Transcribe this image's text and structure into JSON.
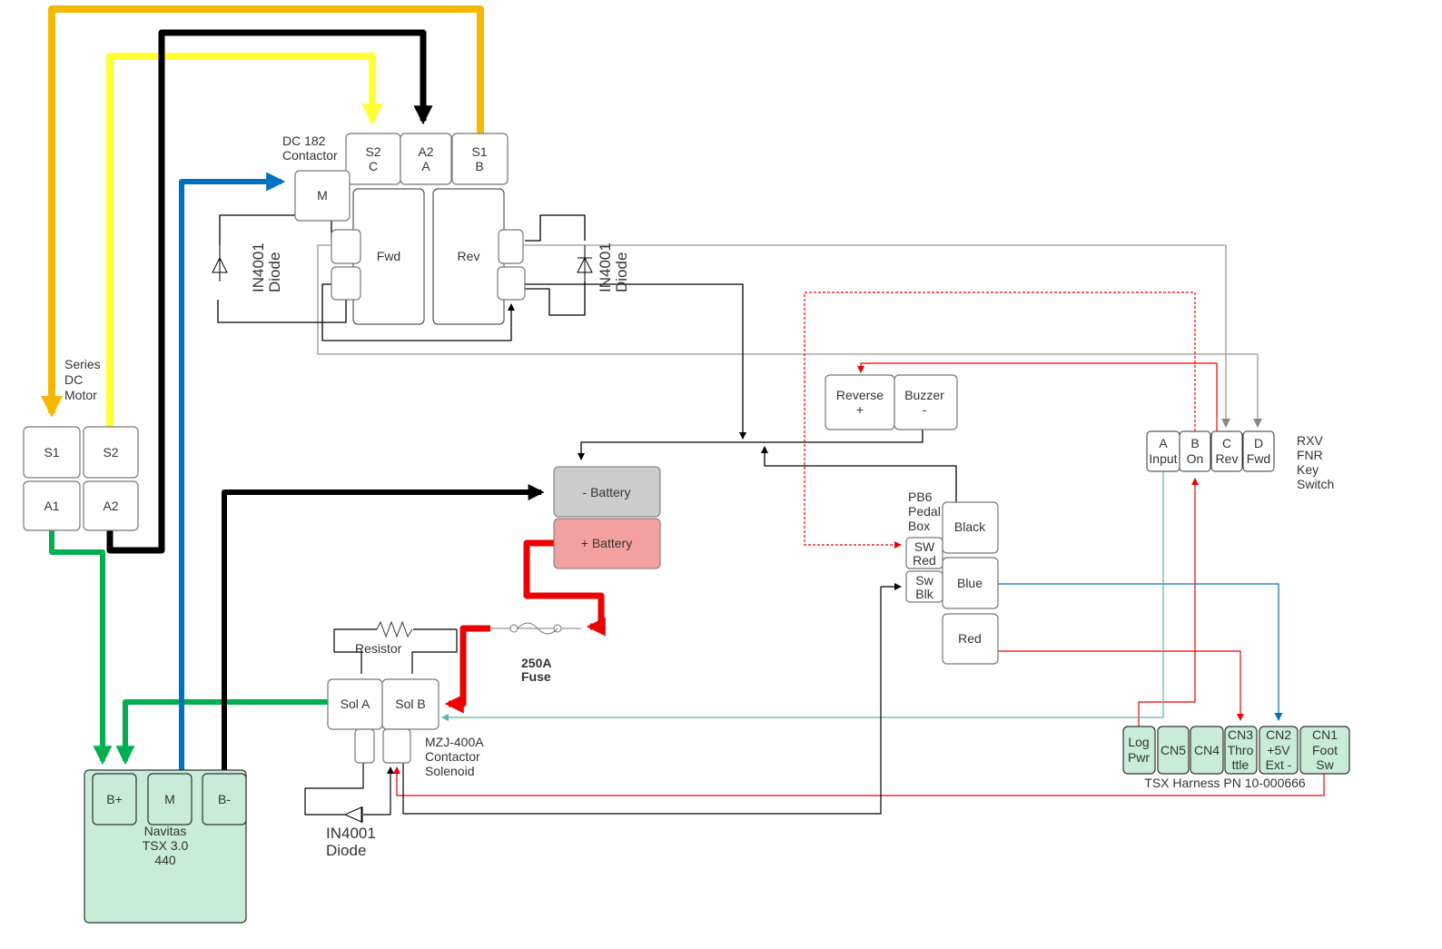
{
  "colors": {
    "orange": "#f5b800",
    "yellow": "#ffff33",
    "black": "#000000",
    "green": "#00b050",
    "blue": "#0070c0",
    "red": "#ee0000",
    "gray": "#999999",
    "teal": "#5fb3a0",
    "controller_fill": "#c8ecd8",
    "neg_battery": "#cccccc",
    "pos_battery": "#f4a0a0"
  },
  "motor": {
    "label": [
      "Series",
      "DC",
      "Motor"
    ],
    "s1": "S1",
    "s2": "S2",
    "a1": "A1",
    "a2": "A2"
  },
  "contactor": {
    "label": [
      "DC 182",
      "Contactor"
    ],
    "s2c": [
      "S2",
      "C"
    ],
    "a2a": [
      "A2",
      "A"
    ],
    "s1b": [
      "S1",
      "B"
    ],
    "m": "M",
    "fwd": "Fwd",
    "rev": "Rev"
  },
  "diodes": {
    "label": [
      "IN4001",
      "Diode"
    ]
  },
  "reverse_buzzer": {
    "reverse": [
      "Reverse",
      "+"
    ],
    "buzzer": [
      "Buzzer",
      "-"
    ]
  },
  "battery": {
    "neg": "- Battery",
    "pos": "+ Battery"
  },
  "fuse": {
    "label": [
      "250A",
      "Fuse"
    ]
  },
  "resistor": {
    "label": "Resistor"
  },
  "solenoid": {
    "sol_a": "Sol A",
    "sol_b": "Sol B",
    "label": [
      "MZJ-400A",
      "Contactor",
      "Solenoid"
    ]
  },
  "pedal_box": {
    "label": [
      "PB6",
      "Pedal",
      "Box"
    ],
    "black": "Black",
    "blue": "Blue",
    "red": "Red",
    "sw_red": [
      "SW",
      "Red"
    ],
    "sw_blk": [
      "Sw",
      "Blk"
    ]
  },
  "key_switch": {
    "label": [
      "RXV",
      "FNR",
      "Key",
      "Switch"
    ],
    "a": [
      "A",
      "Input"
    ],
    "b": [
      "B",
      "On"
    ],
    "c": [
      "C",
      "Rev"
    ],
    "d": [
      "D",
      "Fwd"
    ]
  },
  "harness": {
    "label": "TSX Harness PN 10-000666",
    "log_pwr": [
      "Log",
      "Pwr"
    ],
    "cn5": "CN5",
    "cn4": "CN4",
    "cn3": [
      "CN3",
      "Thro",
      "ttle"
    ],
    "cn2": [
      "CN2",
      "+5V",
      "Ext -"
    ],
    "cn1": [
      "CN1",
      "Foot",
      "Sw"
    ]
  },
  "controller": {
    "label": [
      "Navitas",
      "TSX 3.0",
      "440"
    ],
    "bplus": "B+",
    "m": "M",
    "bminus": "B-"
  }
}
